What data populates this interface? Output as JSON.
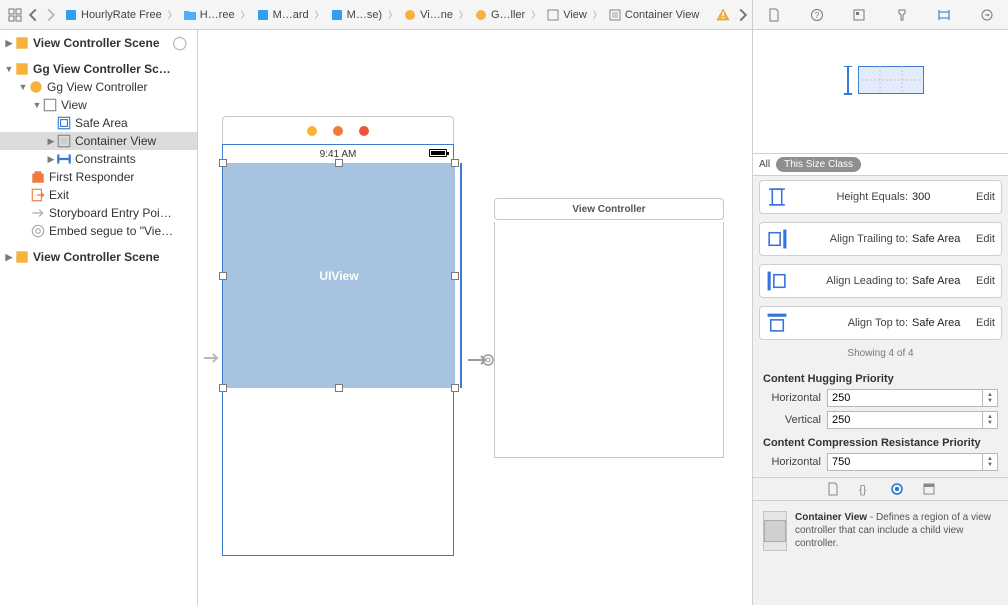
{
  "breadcrumb": {
    "items": [
      {
        "label": "HourlyRate Free",
        "icon": "story"
      },
      {
        "label": "H…ree",
        "icon": "folder"
      },
      {
        "label": "M…ard",
        "icon": "story"
      },
      {
        "label": "M…se)",
        "icon": "story"
      },
      {
        "label": "Vi…ne",
        "icon": "ctrl"
      },
      {
        "label": "G…ller",
        "icon": "ctrl"
      },
      {
        "label": "View",
        "icon": "view"
      },
      {
        "label": "Container View",
        "icon": "view"
      }
    ]
  },
  "outline": {
    "scene1": "View Controller Scene",
    "scene2": "Gg View Controller Sc…",
    "ggController": "Gg View Controller",
    "view": "View",
    "safeArea": "Safe Area",
    "containerView": "Container View",
    "constraints": "Constraints",
    "firstResponder": "First Responder",
    "exit": "Exit",
    "entryPoint": "Storyboard Entry Poi…",
    "embedSegue": "Embed segue to \"Vie…",
    "scene3": "View Controller Scene"
  },
  "canvas": {
    "statusTime": "9:41 AM",
    "uiviewLabel": "UIView",
    "vc2Title": "View Controller"
  },
  "inspector": {
    "sizeAll": "All",
    "sizeClass": "This Size Class",
    "constraints": [
      {
        "icon": "height",
        "label": "Height Equals:",
        "value": "300",
        "edit": "Edit"
      },
      {
        "icon": "trailing",
        "label": "Align Trailing to:",
        "value": "Safe Area",
        "edit": "Edit"
      },
      {
        "icon": "leading",
        "label": "Align Leading to:",
        "value": "Safe Area",
        "edit": "Edit"
      },
      {
        "icon": "top",
        "label": "Align Top to:",
        "value": "Safe Area",
        "edit": "Edit"
      }
    ],
    "showing": "Showing 4 of 4",
    "hugging": {
      "title": "Content Hugging Priority",
      "horizontalLabel": "Horizontal",
      "horizontal": "250",
      "verticalLabel": "Vertical",
      "vertical": "250"
    },
    "compression": {
      "title": "Content Compression Resistance Priority",
      "horizontalLabel": "Horizontal",
      "horizontal": "750"
    },
    "descTitle": "Container View",
    "descBody": " - Defines a region of a view controller that can include a child view controller."
  }
}
